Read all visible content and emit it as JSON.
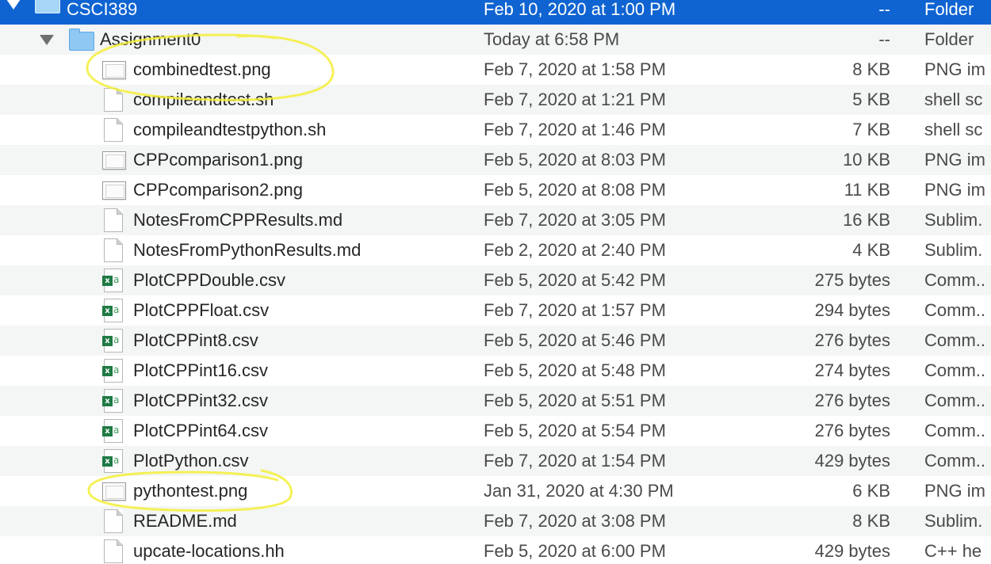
{
  "accent_color": "#0f64d2",
  "highlight_color": "#f3ef3a",
  "rows": [
    {
      "name": "CSCI389",
      "date": "Feb 10, 2020 at 1:00 PM",
      "size": "--",
      "kind": "Folder",
      "icon": "folder-icon",
      "level": 0,
      "selected": true,
      "expanded": true
    },
    {
      "name": "Assignment0",
      "date": "Today at 6:58 PM",
      "size": "--",
      "kind": "Folder",
      "icon": "folder-icon",
      "level": 1,
      "expanded": true
    },
    {
      "name": "combinedtest.png",
      "date": "Feb 7, 2020 at 1:58 PM",
      "size": "8 KB",
      "kind": "PNG im",
      "icon": "image-file-icon",
      "level": 2,
      "circled": true
    },
    {
      "name": "compileandtest.sh",
      "date": "Feb 7, 2020 at 1:21 PM",
      "size": "5 KB",
      "kind": "shell sc",
      "icon": "document-icon",
      "level": 2
    },
    {
      "name": "compileandtestpython.sh",
      "date": "Feb 7, 2020 at 1:46 PM",
      "size": "7 KB",
      "kind": "shell sc",
      "icon": "document-icon",
      "level": 2
    },
    {
      "name": "CPPcomparison1.png",
      "date": "Feb 5, 2020 at 8:03 PM",
      "size": "10 KB",
      "kind": "PNG im",
      "icon": "image-file-icon",
      "level": 2
    },
    {
      "name": "CPPcomparison2.png",
      "date": "Feb 5, 2020 at 8:08 PM",
      "size": "11 KB",
      "kind": "PNG im",
      "icon": "image-file-icon",
      "level": 2
    },
    {
      "name": "NotesFromCPPResults.md",
      "date": "Feb 7, 2020 at 3:05 PM",
      "size": "16 KB",
      "kind": "Sublim.",
      "icon": "document-icon",
      "level": 2
    },
    {
      "name": "NotesFromPythonResults.md",
      "date": "Feb 2, 2020 at 2:40 PM",
      "size": "4 KB",
      "kind": "Sublim.",
      "icon": "document-icon",
      "level": 2
    },
    {
      "name": "PlotCPPDouble.csv",
      "date": "Feb 5, 2020 at 5:42 PM",
      "size": "275 bytes",
      "kind": "Comm..",
      "icon": "spreadsheet-icon",
      "level": 2
    },
    {
      "name": "PlotCPPFloat.csv",
      "date": "Feb 7, 2020 at 1:57 PM",
      "size": "294 bytes",
      "kind": "Comm..",
      "icon": "spreadsheet-icon",
      "level": 2
    },
    {
      "name": "PlotCPPint8.csv",
      "date": "Feb 5, 2020 at 5:46 PM",
      "size": "276 bytes",
      "kind": "Comm..",
      "icon": "spreadsheet-icon",
      "level": 2
    },
    {
      "name": "PlotCPPint16.csv",
      "date": "Feb 5, 2020 at 5:48 PM",
      "size": "274 bytes",
      "kind": "Comm..",
      "icon": "spreadsheet-icon",
      "level": 2
    },
    {
      "name": "PlotCPPint32.csv",
      "date": "Feb 5, 2020 at 5:51 PM",
      "size": "276 bytes",
      "kind": "Comm..",
      "icon": "spreadsheet-icon",
      "level": 2
    },
    {
      "name": "PlotCPPint64.csv",
      "date": "Feb 5, 2020 at 5:54 PM",
      "size": "276 bytes",
      "kind": "Comm..",
      "icon": "spreadsheet-icon",
      "level": 2
    },
    {
      "name": "PlotPython.csv",
      "date": "Feb 7, 2020 at 1:54 PM",
      "size": "429 bytes",
      "kind": "Comm..",
      "icon": "spreadsheet-icon",
      "level": 2
    },
    {
      "name": "pythontest.png",
      "date": "Jan 31, 2020 at 4:30 PM",
      "size": "6 KB",
      "kind": "PNG im",
      "icon": "image-file-icon",
      "level": 2,
      "circled": true
    },
    {
      "name": "README.md",
      "date": "Feb 7, 2020 at 3:08 PM",
      "size": "8 KB",
      "kind": "Sublim.",
      "icon": "document-icon",
      "level": 2
    },
    {
      "name": "upcate-locations.hh",
      "date": "Feb 5, 2020 at 6:00 PM",
      "size": "429 bytes",
      "kind": "C++ he",
      "icon": "document-icon",
      "level": 2
    }
  ]
}
